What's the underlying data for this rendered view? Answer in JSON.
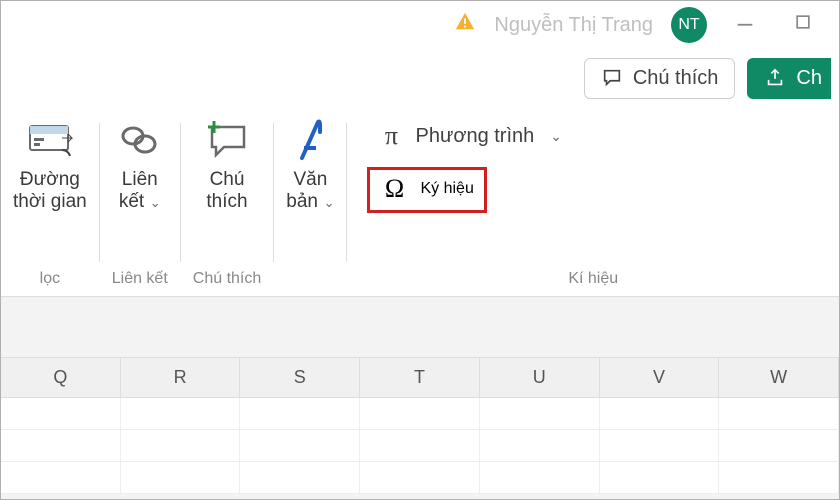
{
  "titlebar": {
    "username": "Nguyễn Thị Trang",
    "avatar_initials": "NT"
  },
  "actionbar": {
    "comments_label": "Chú thích",
    "share_label": "Ch"
  },
  "ribbon": {
    "filters_group_label": "lọc",
    "timeline": {
      "line1": "Đường",
      "line2": "thời gian"
    },
    "links_group_label": "Liên kết",
    "link": {
      "line1": "Liên",
      "line2_prefix": "kết"
    },
    "comments_group_label": "Chú thích",
    "comment": {
      "line1": "Chú",
      "line2": "thích"
    },
    "text": {
      "line1": "Văn",
      "line2_prefix": "bản"
    },
    "symbols_group_label": "Kí hiệu",
    "equation_label": "Phương trình",
    "symbol_label": "Ký hiệu"
  },
  "columns": [
    "Q",
    "R",
    "S",
    "T",
    "U",
    "V",
    "W"
  ]
}
